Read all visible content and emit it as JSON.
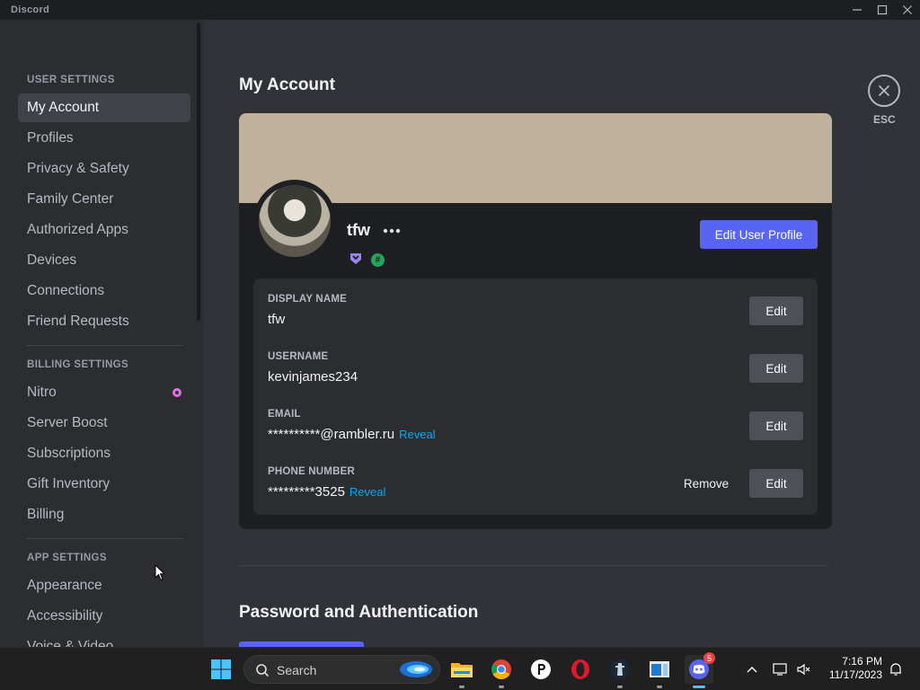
{
  "window": {
    "app_name": "Discord"
  },
  "sidebar": {
    "user_settings_header": "USER SETTINGS",
    "user_items": [
      {
        "label": "My Account"
      },
      {
        "label": "Profiles"
      },
      {
        "label": "Privacy & Safety"
      },
      {
        "label": "Family Center"
      },
      {
        "label": "Authorized Apps"
      },
      {
        "label": "Devices"
      },
      {
        "label": "Connections"
      },
      {
        "label": "Friend Requests"
      }
    ],
    "billing_settings_header": "BILLING SETTINGS",
    "billing_items": [
      {
        "label": "Nitro"
      },
      {
        "label": "Server Boost"
      },
      {
        "label": "Subscriptions"
      },
      {
        "label": "Gift Inventory"
      },
      {
        "label": "Billing"
      }
    ],
    "app_settings_header": "APP SETTINGS",
    "app_items": [
      {
        "label": "Appearance"
      },
      {
        "label": "Accessibility"
      },
      {
        "label": "Voice & Video"
      }
    ]
  },
  "main": {
    "title": "My Account",
    "close_label": "ESC",
    "profile": {
      "name": "tfw",
      "edit_profile_label": "Edit User Profile",
      "banner_color": "#bfb19b",
      "badges": [
        "hypesquad-icon",
        "hash-badge-icon"
      ],
      "hash_glyph": "#"
    },
    "fields": [
      {
        "label": "DISPLAY NAME",
        "value": "tfw",
        "edit": "Edit"
      },
      {
        "label": "USERNAME",
        "value": "kevinjames234",
        "edit": "Edit"
      },
      {
        "label": "EMAIL",
        "value": "**********@rambler.ru",
        "reveal": "Reveal",
        "edit": "Edit"
      },
      {
        "label": "PHONE NUMBER",
        "value": "*********3525",
        "reveal": "Reveal",
        "remove": "Remove",
        "edit": "Edit"
      }
    ],
    "section_title": "Password and Authentication"
  },
  "taskbar": {
    "search_label": "Search",
    "discord_badge": "5",
    "time": "7:16 PM",
    "date": "11/17/2023",
    "pinned_icons": [
      "windows-start-icon",
      "file-explorer-icon",
      "chrome-icon",
      "p-app-icon",
      "opera-icon",
      "steam-icon",
      "window-app-icon",
      "discord-icon"
    ]
  },
  "colors": {
    "accent": "#5865f2",
    "link": "#00a8fc",
    "bg": "#313338",
    "sidebar": "#2b2d31"
  }
}
